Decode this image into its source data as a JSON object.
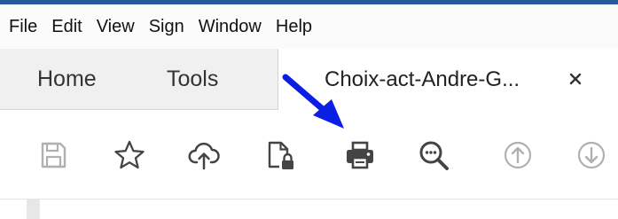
{
  "menu": [
    "File",
    "Edit",
    "View",
    "Sign",
    "Window",
    "Help"
  ],
  "tabs": {
    "home": "Home",
    "tools": "Tools",
    "document": "Choix-act-Andre-G..."
  },
  "colors": {
    "top_accent": "#2a5a9e",
    "annotation_arrow": "#0a1ee6",
    "icon": "#444444",
    "icon_disabled": "#b0b0b0"
  },
  "toolbar_icons": [
    "save-icon",
    "star-icon",
    "cloud-upload-icon",
    "lock-file-icon",
    "print-icon",
    "zoom-out-icon",
    "page-up-icon",
    "page-down-icon"
  ]
}
